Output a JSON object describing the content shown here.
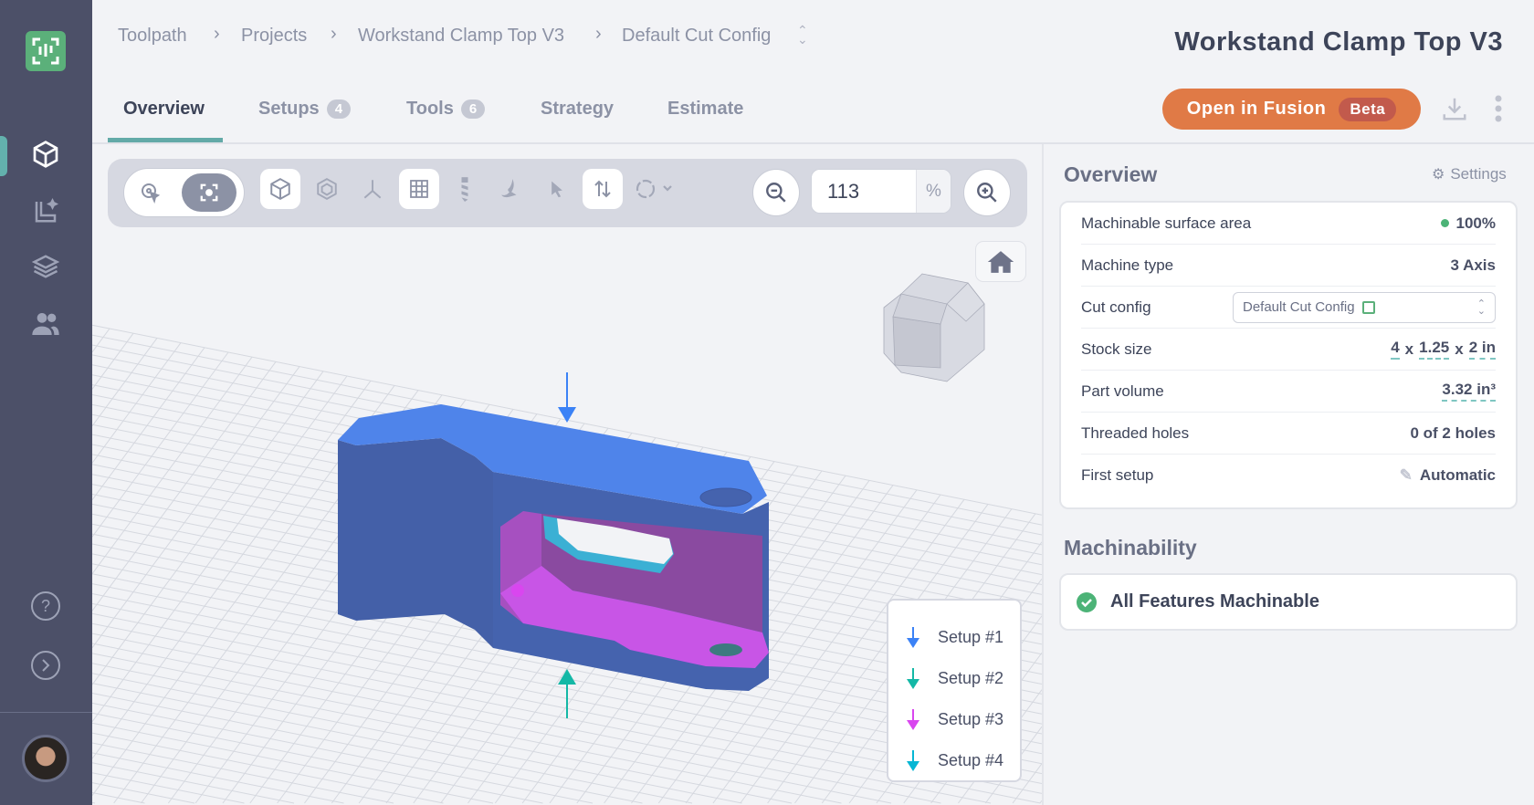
{
  "breadcrumb": [
    "Toolpath",
    "Projects",
    "Workstand Clamp Top V3",
    "Default Cut Config"
  ],
  "title": "Workstand Clamp Top V3",
  "tabs": [
    {
      "label": "Overview"
    },
    {
      "label": "Setups",
      "count": "4"
    },
    {
      "label": "Tools",
      "count": "6"
    },
    {
      "label": "Strategy"
    },
    {
      "label": "Estimate"
    }
  ],
  "fusion": {
    "label": "Open in Fusion",
    "badge": "Beta"
  },
  "zoom": {
    "value": "113",
    "unit": "%"
  },
  "legend": [
    "Setup #1",
    "Setup #2",
    "Setup #3",
    "Setup #4"
  ],
  "setup_colors": [
    "#3b82f6",
    "#14b8a6",
    "#d946ef",
    "#06b6d4"
  ],
  "overview": {
    "heading": "Overview",
    "settings": "Settings",
    "rows": [
      {
        "k": "Machinable surface area",
        "v": "100%"
      },
      {
        "k": "Machine type",
        "v": "3 Axis"
      },
      {
        "k": "Cut config",
        "v": "Default Cut Config"
      },
      {
        "k": "Stock size",
        "v": [
          "4",
          "x",
          "1.25",
          "x",
          "2 in"
        ]
      },
      {
        "k": "Part volume",
        "v": "3.32 in³"
      },
      {
        "k": "Threaded holes",
        "v": "0 of 2 holes"
      },
      {
        "k": "First setup",
        "v": "Automatic"
      }
    ]
  },
  "machinability": {
    "heading": "Machinability",
    "status": "All Features Machinable"
  },
  "colors": {
    "accent": "#63b1ad",
    "fusion": "#e07a46",
    "success": "#4cb377"
  }
}
